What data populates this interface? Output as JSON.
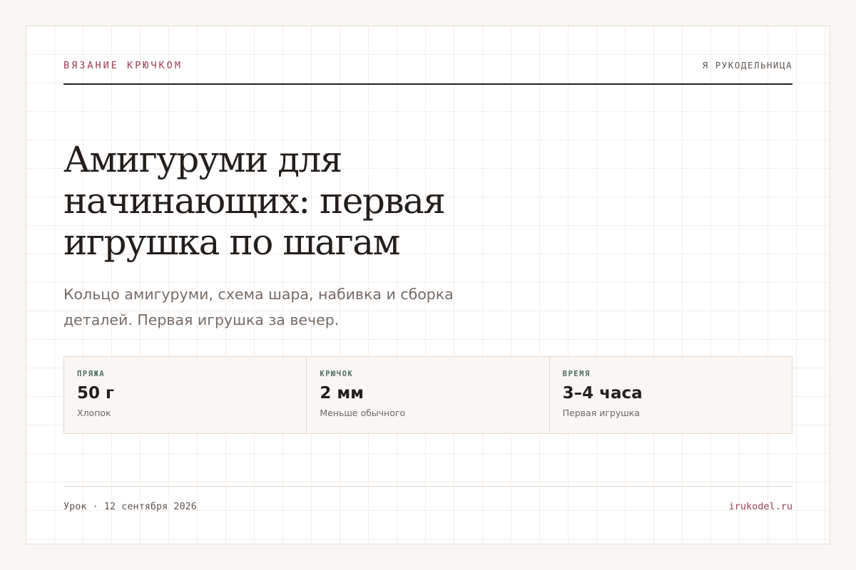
{
  "header": {
    "category": "ВЯЗАНИЕ КРЮЧКОМ",
    "brand": "Я РУКОДЕЛЬНИЦА"
  },
  "article": {
    "title": "Амигуруми для начинающих: первая игрушка по шагам",
    "subtitle": "Кольцо амигуруми, схема шара, набивка и сборка деталей. Первая игрушка за вечер."
  },
  "stats": [
    {
      "label": "ПРЯЖА",
      "value": "50 г",
      "note": "Хлопок"
    },
    {
      "label": "КРЮЧОК",
      "value": "2 мм",
      "note": "Меньше обычного"
    },
    {
      "label": "ВРЕМЯ",
      "value": "3–4 часа",
      "note": "Первая игрушка"
    }
  ],
  "footer": {
    "meta": "Урок · 12 сентября 2026",
    "site": "irukodel.ru"
  },
  "colors": {
    "accent": "#9b3d4f",
    "label_green": "#4f6f5c",
    "text_dark": "#241f1c",
    "background": "#f9f6f3"
  }
}
